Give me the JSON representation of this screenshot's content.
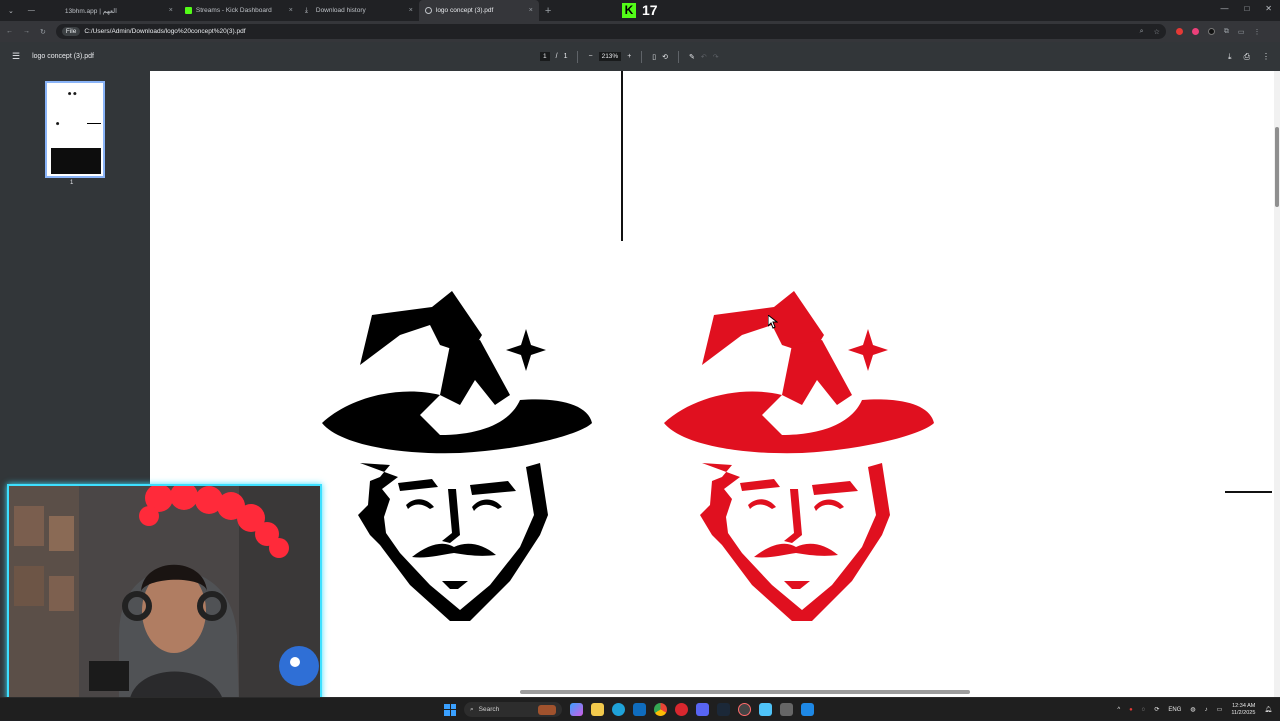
{
  "tabs": [
    {
      "label": "13bhm.app | العهم",
      "active": false
    },
    {
      "label": "Streams - Kick Dashboard",
      "active": false
    },
    {
      "label": "Download history",
      "active": false
    },
    {
      "label": "logo concept (3).pdf",
      "active": true
    }
  ],
  "new_tab_glyph": "+",
  "close_glyph": "×",
  "kick": {
    "count": "17",
    "logo_letter": "K"
  },
  "window_controls": [
    "—",
    "□",
    "✕"
  ],
  "address": {
    "chip": "File",
    "url": "C:/Users/Admin/Downloads/logo%20concept%20(3).pdf"
  },
  "pdf": {
    "title": "logo concept (3).pdf",
    "page_current": "1",
    "page_sep": "/",
    "page_total": "1",
    "zoom": "213%",
    "zoom_out": "−",
    "zoom_in": "+",
    "thumbnail_label": "1"
  },
  "taskbar": {
    "search_placeholder": "Search",
    "lang": "ENG",
    "time": "12:34 AM",
    "date": "11/2/2025"
  },
  "colors": {
    "logo_red": "#e0101f",
    "logo_black": "#000000",
    "accent_blue": "#8ab4f8",
    "kick_green": "#53fc18",
    "webcam_border": "#3ee0ff"
  }
}
